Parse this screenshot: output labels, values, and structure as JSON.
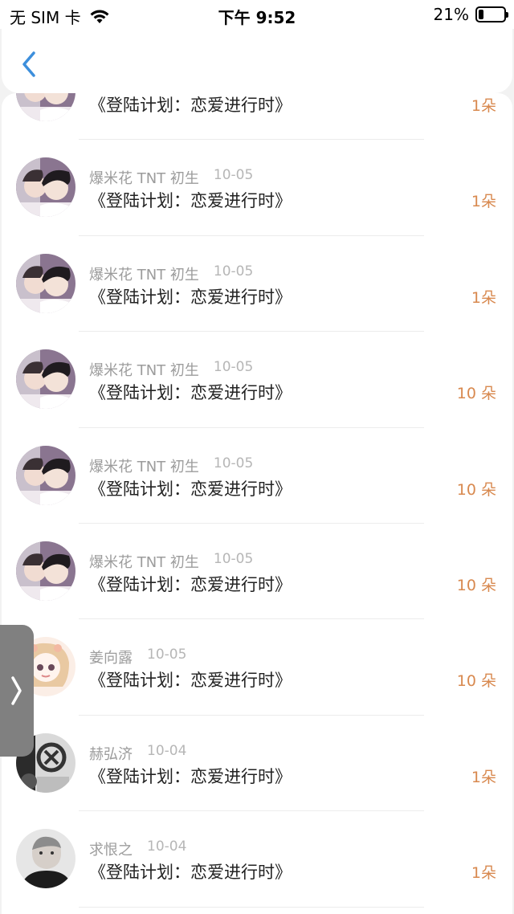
{
  "status": {
    "carrier": "无 SIM 卡",
    "time": "下午 9:52",
    "battery": "21%",
    "battery_level": 0.21
  },
  "icons": {
    "back": "chevron-left-icon",
    "wifi": "wifi-icon",
    "side_handle": "chevron-right-icon"
  },
  "colors": {
    "amount": "#d8894f",
    "back_arrow": "#3d8fdc"
  },
  "records": [
    {
      "user": "",
      "date": "",
      "title": "《登陆计划：恋爱进行时》",
      "amount": "1朵",
      "avatar": "couple"
    },
    {
      "user": "爆米花 TNT 初生",
      "date": "10-05",
      "title": "《登陆计划：恋爱进行时》",
      "amount": "1朵",
      "avatar": "couple"
    },
    {
      "user": "爆米花 TNT 初生",
      "date": "10-05",
      "title": "《登陆计划：恋爱进行时》",
      "amount": "1朵",
      "avatar": "couple"
    },
    {
      "user": "爆米花 TNT 初生",
      "date": "10-05",
      "title": "《登陆计划：恋爱进行时》",
      "amount": "10 朵",
      "avatar": "couple"
    },
    {
      "user": "爆米花 TNT 初生",
      "date": "10-05",
      "title": "《登陆计划：恋爱进行时》",
      "amount": "10 朵",
      "avatar": "couple"
    },
    {
      "user": "爆米花 TNT 初生",
      "date": "10-05",
      "title": "《登陆计划：恋爱进行时》",
      "amount": "10 朵",
      "avatar": "couple"
    },
    {
      "user": "姜向露",
      "date": "10-05",
      "title": "《登陆计划：恋爱进行时》",
      "amount": "10 朵",
      "avatar": "anime"
    },
    {
      "user": "赫弘济",
      "date": "10-04",
      "title": "《登陆计划：恋爱进行时》",
      "amount": "1朵",
      "avatar": "mono"
    },
    {
      "user": "求恨之",
      "date": "10-04",
      "title": "《登陆计划：恋爱进行时》",
      "amount": "1朵",
      "avatar": "portrait"
    }
  ]
}
